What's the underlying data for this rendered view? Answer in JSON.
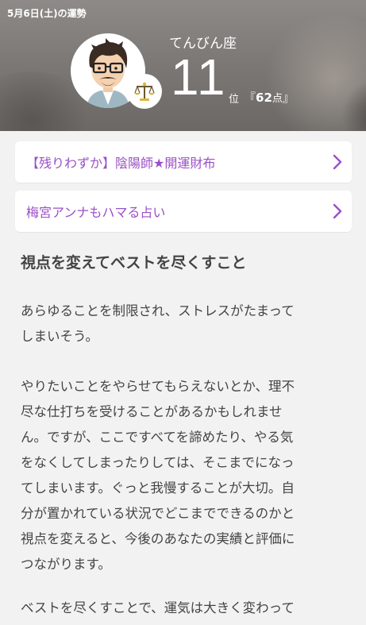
{
  "header": {
    "date_label": "5月6日(土)の運勢",
    "sign_name": "てんびん座",
    "rank": "11",
    "rank_unit": "位",
    "score_open": "『",
    "score_value": "62",
    "score_unit": "点",
    "score_close": "』",
    "avatar_icon": "fortune-teller-avatar-icon",
    "zodiac_icon": "libra-scales-icon"
  },
  "links": [
    {
      "label": "【残りわずか】陰陽師★開運財布",
      "icon": "chevron-right-icon"
    },
    {
      "label": "梅宮アンナもハマる占い",
      "icon": "chevron-right-icon"
    }
  ],
  "article": {
    "title": "視点を変えてベストを尽くすこと",
    "paragraphs": [
      [
        "あらゆることを制限され、ストレスがたまって",
        "しまいそう。"
      ],
      [
        "やりたいことをやらせてもらえないとか、理不",
        "尽な仕打ちを受けることがあるかもしれませ",
        "ん。ですが、ここですべてを諦めたり、やる気",
        "をなくしてしまったりしては、そこまでになっ",
        "てしまいます。ぐっと我慢することが大切。自",
        "分が置かれている状況でどこまでできるのかと",
        "視点を変えると、今後のあなたの実績と評価に",
        "つながります。"
      ],
      [
        "ベストを尽くすことで、運気は大きく変わって"
      ]
    ]
  },
  "colors": {
    "link_text": "#9b4fc6",
    "body_text": "#444444",
    "page_bg": "#f2f2f2"
  }
}
